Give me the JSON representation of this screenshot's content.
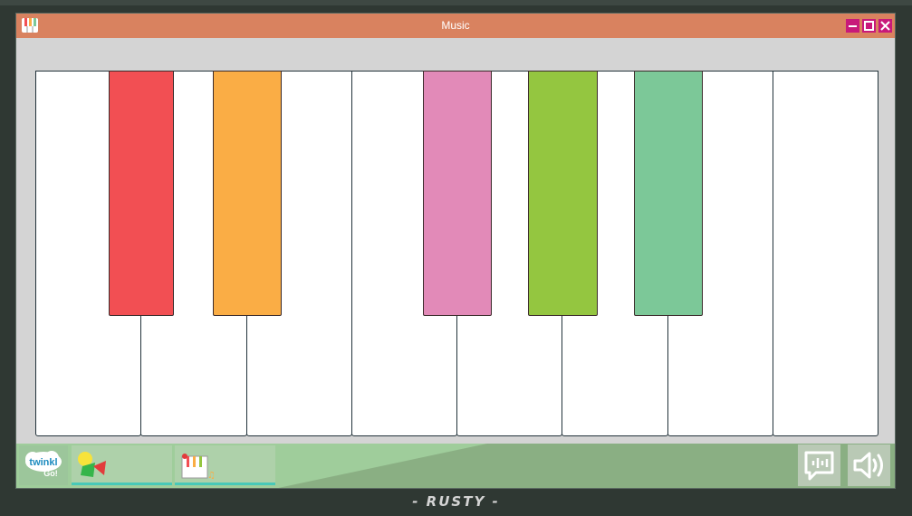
{
  "window": {
    "title": "Music",
    "titlebar_color": "#d9825f",
    "controls": [
      "minimize-icon",
      "maximize-icon",
      "close-icon"
    ],
    "app_icon": "piano-icon"
  },
  "piano": {
    "white_key_count": 8,
    "black_keys": [
      {
        "color": "#f24f53"
      },
      {
        "color": "#faad45"
      },
      {
        "color": "#e28ab8"
      },
      {
        "color": "#94c640"
      },
      {
        "color": "#7cc898"
      }
    ]
  },
  "taskbar": {
    "launcher": {
      "line1": "twinkl",
      "line2": "Go!",
      "icon": "twinkl-go-logo"
    },
    "items": [
      {
        "icon": "shapes-app-icon",
        "active": true
      },
      {
        "icon": "piano-app-icon",
        "active": true
      }
    ],
    "controls": [
      {
        "icon": "speech-icon"
      },
      {
        "icon": "speaker-icon"
      }
    ]
  },
  "device": {
    "brand": "- RUSTY -"
  }
}
